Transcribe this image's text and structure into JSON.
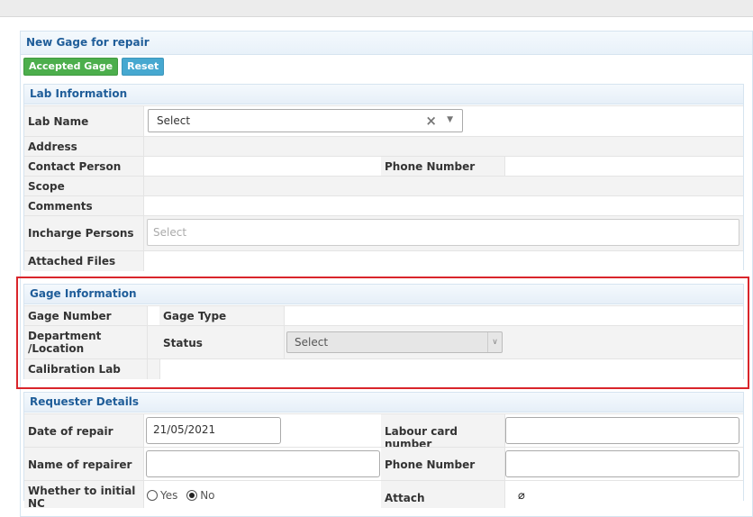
{
  "panel": {
    "title": "New Gage for repair"
  },
  "toolbar": {
    "accept_label": "Accepted Gage",
    "reset_label": "Reset"
  },
  "lab": {
    "heading": "Lab Information",
    "lab_name_label": "Lab Name",
    "lab_name_value": "Select",
    "address_label": "Address",
    "contact_label": "Contact Person",
    "phone_label": "Phone Number",
    "scope_label": "Scope",
    "comments_label": "Comments",
    "incharge_label": "Incharge Persons",
    "incharge_placeholder": "Select",
    "attached_label": "Attached Files"
  },
  "gage": {
    "heading": "Gage Information",
    "number_label": "Gage Number",
    "type_label": "Gage Type",
    "dept_label_1": "Department",
    "dept_label_2": "/Location",
    "status_label": "Status",
    "status_value": "Select",
    "calib_label": "Calibration Lab"
  },
  "requester": {
    "heading": "Requester Details",
    "date_label": "Date of repair",
    "date_value": "21/05/2021",
    "labour_label": "Labour card number",
    "name_label": "Name of repairer",
    "phone_label": "Phone Number",
    "initial_label_1": "Whether to initial",
    "initial_label_2": "NC",
    "yes_label": "Yes",
    "no_label": "No",
    "attach_label": "Attach"
  },
  "highlight_color": "#d9252b",
  "icons": [
    "clear-icon",
    "dropdown-caret-icon",
    "paperclip-icon"
  ]
}
